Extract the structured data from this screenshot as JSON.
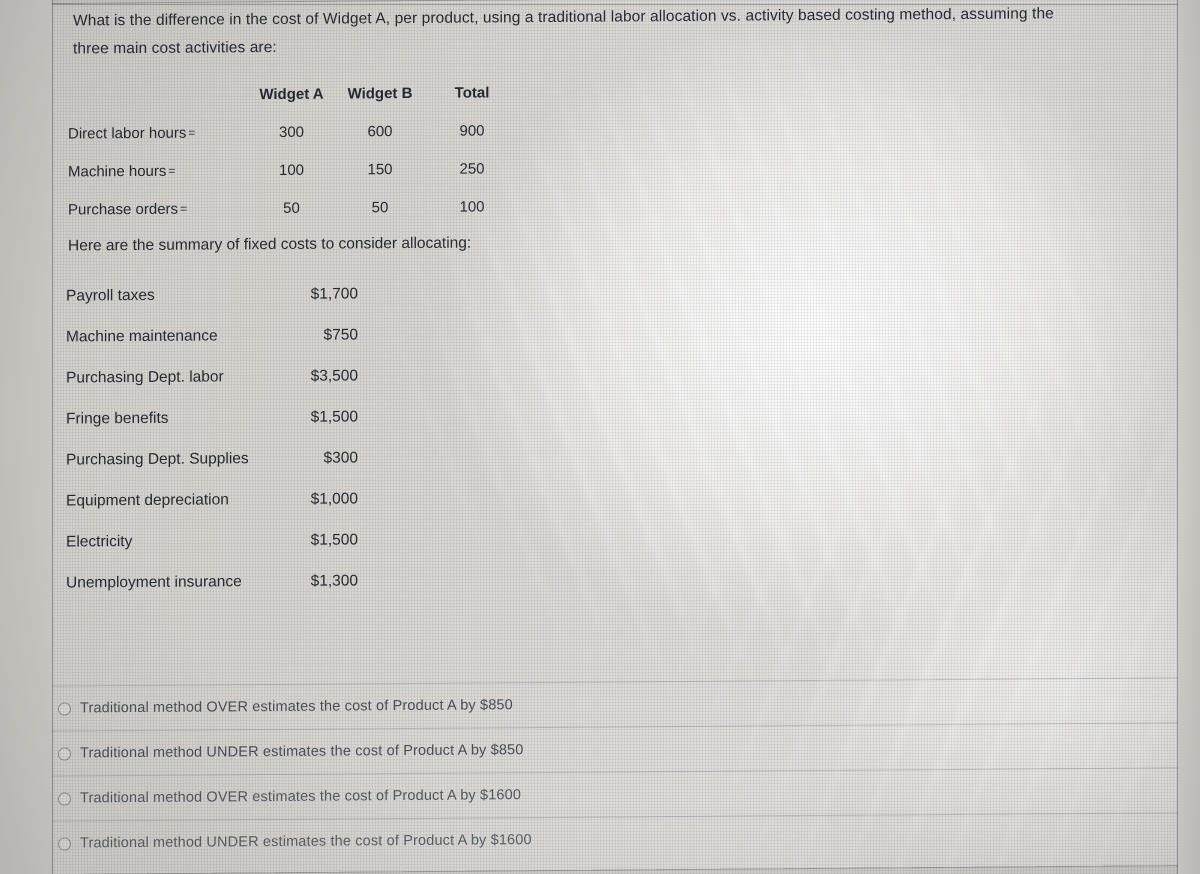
{
  "question": {
    "line1": "What is the difference in the cost of Widget A, per product, using a traditional labor allocation vs. activity based costing method, assuming the",
    "line2": "three main cost activities are:"
  },
  "activity_table": {
    "headers": [
      "",
      "Widget A",
      "Widget B",
      "Total"
    ],
    "rows": [
      {
        "label": "Direct labor hours",
        "eq": "=",
        "widget_a": "300",
        "widget_b": "600",
        "total": "900"
      },
      {
        "label": "Machine hours",
        "eq": "=",
        "widget_a": "100",
        "widget_b": "150",
        "total": "250"
      },
      {
        "label": "Purchase orders",
        "eq": "=",
        "widget_a": "50",
        "widget_b": "50",
        "total": "100"
      }
    ]
  },
  "summary_heading": "Here are the summary of fixed costs to consider allocating:",
  "fixed_costs": [
    {
      "label": "Payroll taxes",
      "amount": "$1,700"
    },
    {
      "label": "Machine maintenance",
      "amount": "$750"
    },
    {
      "label": "Purchasing Dept. labor",
      "amount": "$3,500"
    },
    {
      "label": "Fringe benefits",
      "amount": "$1,500"
    },
    {
      "label": "Purchasing Dept. Supplies",
      "amount": "$300"
    },
    {
      "label": "Equipment depreciation",
      "amount": "$1,000"
    },
    {
      "label": "Electricity",
      "amount": "$1,500"
    },
    {
      "label": "Unemployment insurance",
      "amount": "$1,300"
    }
  ],
  "options": [
    {
      "label": "Traditional method OVER estimates the cost of Product A by $850",
      "selected": false
    },
    {
      "label": "Traditional method UNDER estimates the cost of Product A by $850",
      "selected": false
    },
    {
      "label": "Traditional method OVER estimates the cost of Product A by $1600",
      "selected": false
    },
    {
      "label": "Traditional method UNDER estimates the cost of Product A by $1600",
      "selected": false
    }
  ],
  "colors": {
    "ink": "#262b33",
    "option_ink": "#4a5059",
    "sheet": "#dcdad6",
    "gutter": "#c8c6c1",
    "rule": "#7d8086"
  }
}
